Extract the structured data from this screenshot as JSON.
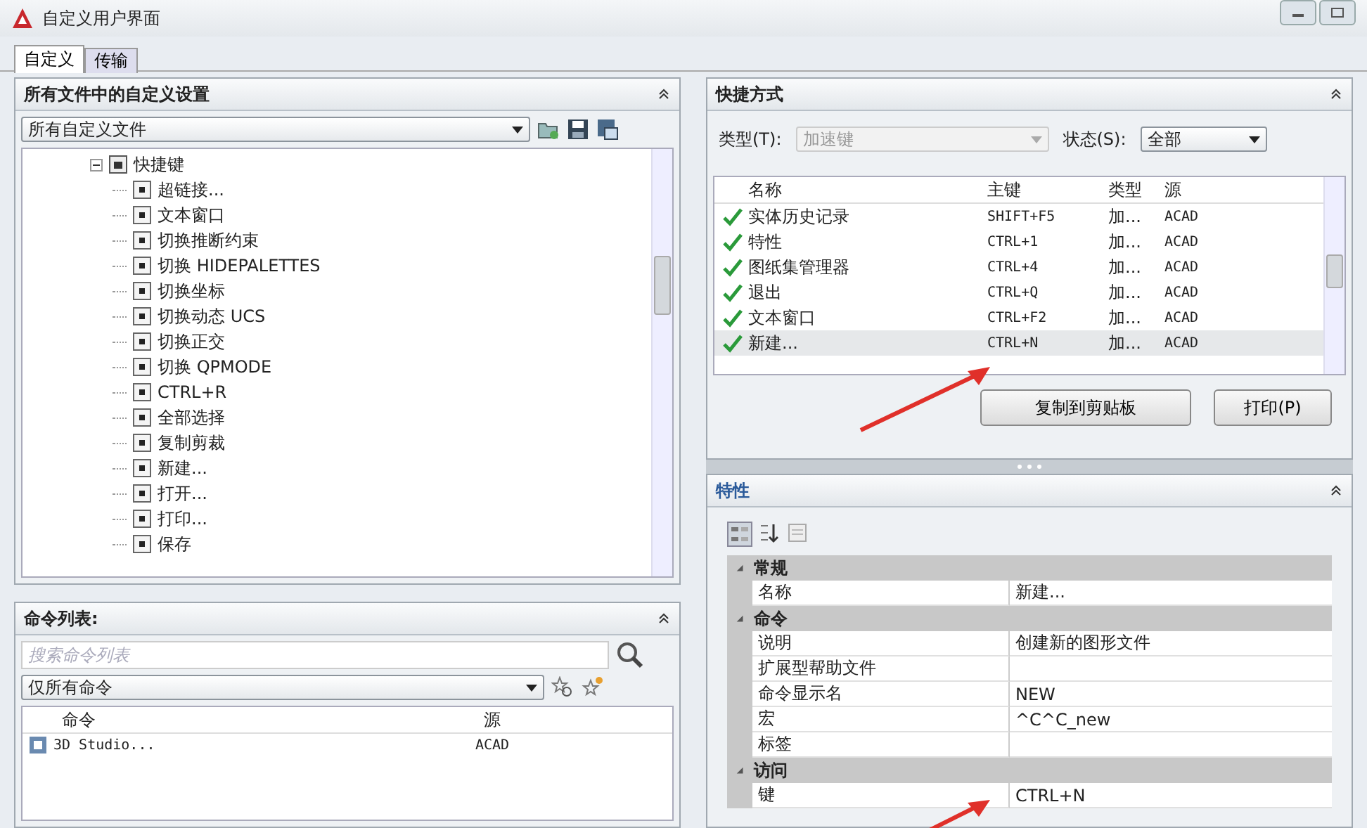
{
  "window": {
    "title": "自定义用户界面"
  },
  "tabs": [
    {
      "label": "自定义",
      "selected": true
    },
    {
      "label": "传输",
      "selected": false
    }
  ],
  "settings_panel": {
    "title": "所有文件中的自定义设置",
    "file_select": "所有自定义文件",
    "tree": {
      "label": "快捷键",
      "expanded": true,
      "children": [
        {
          "label": "超链接..."
        },
        {
          "label": "文本窗口"
        },
        {
          "label": "切换推断约束"
        },
        {
          "label": "切换 HIDEPALETTES"
        },
        {
          "label": "切换坐标"
        },
        {
          "label": "切换动态 UCS"
        },
        {
          "label": "切换正交"
        },
        {
          "label": "切换 QPMODE"
        },
        {
          "label": "CTRL+R"
        },
        {
          "label": "全部选择"
        },
        {
          "label": "复制剪裁"
        },
        {
          "label": "新建..."
        },
        {
          "label": "打开..."
        },
        {
          "label": "打印..."
        },
        {
          "label": "保存"
        }
      ]
    }
  },
  "command_panel": {
    "title": "命令列表:",
    "search": {
      "placeholder": "搜索命令列表"
    },
    "filter": "仅所有命令",
    "columns": [
      "命令",
      "源"
    ],
    "rows": [
      {
        "command": "3D Studio...",
        "source": "ACAD"
      }
    ]
  },
  "shortcuts_panel": {
    "title": "快捷方式",
    "type_label": "类型(T):",
    "type_value": "加速键",
    "status_label": "状态(S):",
    "status_value": "全部",
    "columns": [
      "名称",
      "主键",
      "类型",
      "源"
    ],
    "rows": [
      {
        "name": "实体历史记录",
        "key": "SHIFT+F5",
        "type": "加...",
        "source": "ACAD",
        "selected": false
      },
      {
        "name": "特性",
        "key": "CTRL+1",
        "type": "加...",
        "source": "ACAD",
        "selected": false
      },
      {
        "name": "图纸集管理器",
        "key": "CTRL+4",
        "type": "加...",
        "source": "ACAD",
        "selected": false
      },
      {
        "name": "退出",
        "key": "CTRL+Q",
        "type": "加...",
        "source": "ACAD",
        "selected": false
      },
      {
        "name": "文本窗口",
        "key": "CTRL+F2",
        "type": "加...",
        "source": "ACAD",
        "selected": false
      },
      {
        "name": "新建...",
        "key": "CTRL+N",
        "type": "加...",
        "source": "ACAD",
        "selected": true
      }
    ],
    "buttons": [
      "复制到剪贴板",
      "打印(P)"
    ]
  },
  "properties_panel": {
    "title": "特性",
    "groups": [
      {
        "name": "常规",
        "expanded": true,
        "rows": [
          {
            "name": "名称",
            "value": "新建..."
          }
        ]
      },
      {
        "name": "命令",
        "expanded": true,
        "rows": [
          {
            "name": "说明",
            "value": "创建新的图形文件"
          },
          {
            "name": "扩展型帮助文件",
            "value": ""
          },
          {
            "name": "命令显示名",
            "value": "NEW"
          },
          {
            "name": "宏",
            "value": "^C^C_new"
          },
          {
            "name": "标签",
            "value": ""
          }
        ]
      },
      {
        "name": "访问",
        "expanded": true,
        "rows": [
          {
            "name": "键",
            "value": "CTRL+N"
          }
        ]
      }
    ]
  }
}
